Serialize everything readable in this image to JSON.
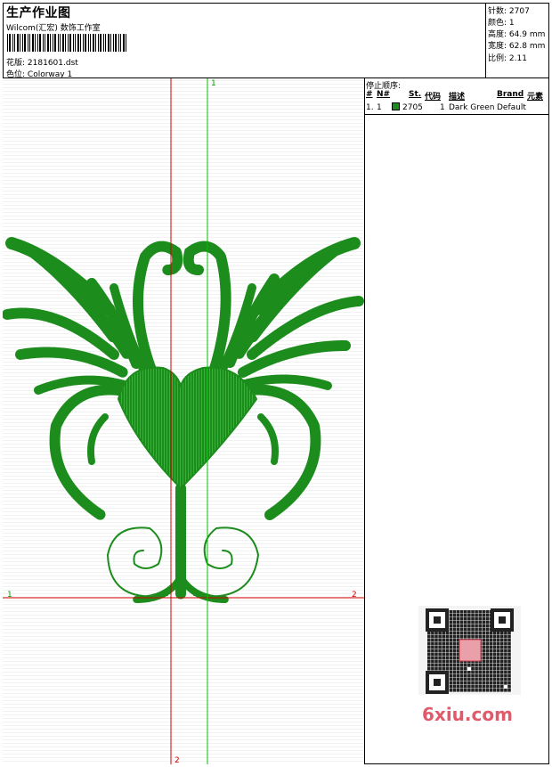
{
  "header": {
    "title": "生产作业图",
    "subtitle": "Wilcom(汇宏) 数饰工作室",
    "design_label": "花版:",
    "design_value": "2181601.dst",
    "colorway_label": "色位:",
    "colorway_value": "Colorway 1"
  },
  "stats": [
    {
      "label": "针数:",
      "value": "2707"
    },
    {
      "label": "颜色:",
      "value": "1"
    },
    {
      "label": "高度:",
      "value": "64.9 mm"
    },
    {
      "label": "宽度:",
      "value": "62.8 mm"
    },
    {
      "label": "比例:",
      "value": "2.11"
    }
  ],
  "stop_sequence": {
    "title": "停止顺序:",
    "columns": [
      "#",
      "N#",
      "St.",
      "代码",
      "描述",
      "Brand",
      "元素"
    ],
    "rows": [
      {
        "index": "1.",
        "needle": "1",
        "stitches": "2705",
        "code": "1",
        "description": "Dark Green",
        "brand": "Default",
        "color": "#1c8c1c"
      }
    ]
  },
  "guides": {
    "green_top_label": "1",
    "left_label": "1",
    "right_label": "2",
    "bottom_label": "2",
    "red_color": "#d00000",
    "green_color": "#00c000"
  },
  "thread_color": "#1c8c1c",
  "watermark": "6xiu.com"
}
